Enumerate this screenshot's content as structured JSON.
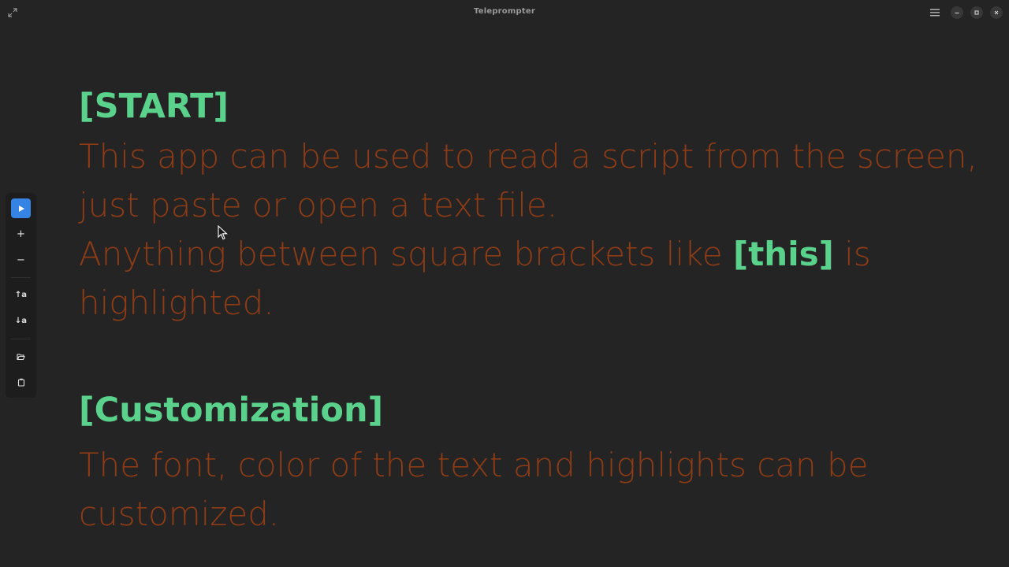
{
  "window": {
    "title": "Teleprompter"
  },
  "icons": {
    "fullscreen": "fullscreen-icon",
    "menu": "hamburger-menu-icon",
    "minimize": "minimize-icon",
    "maximize": "maximize-icon",
    "close": "close-icon",
    "play": "play-icon",
    "zoom_in": "plus-icon",
    "zoom_out": "minus-icon",
    "scroll_up": "text-up-icon",
    "scroll_down": "text-down-icon",
    "open": "folder-open-icon",
    "paste": "clipboard-icon"
  },
  "toolbar": {
    "plus_glyph": "+",
    "minus_glyph": "−",
    "up_glyph": "↑a",
    "down_glyph": "↓a"
  },
  "script": {
    "heading_start": "[START]",
    "para1": "This app can be used to read a script from the screen, just paste or open a text file.",
    "para2_before": "Anything between square brackets like ",
    "para2_highlight": "[this]",
    "para2_after": " is highlighted.",
    "heading_custom": "[Customization]",
    "para3": "The font, color of the text and highlights can be customized."
  },
  "colors": {
    "background": "#242424",
    "text": "#8f3c16",
    "highlight": "#5ad28c",
    "accent": "#3584e4"
  }
}
